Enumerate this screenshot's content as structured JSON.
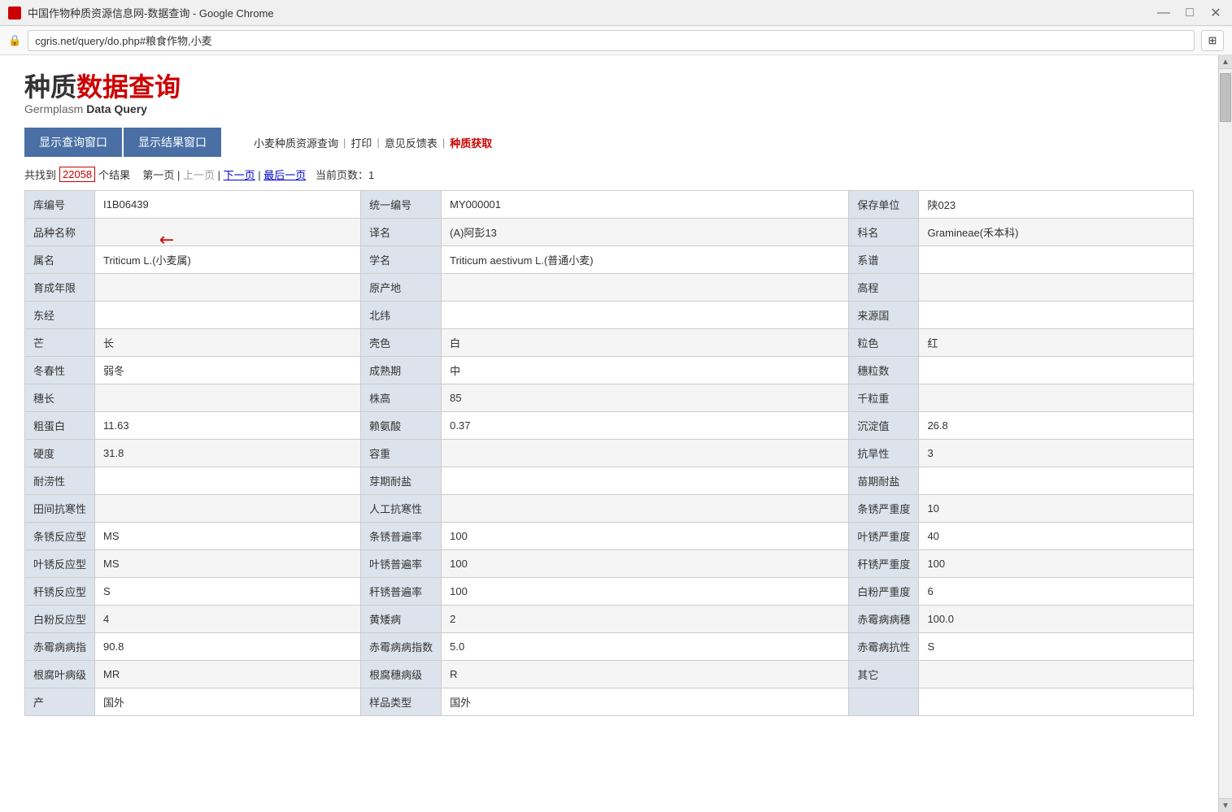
{
  "titlebar": {
    "title": "中国作物种质资源信息网-数据查询 - Google Chrome",
    "controls": {
      "minimize": "—",
      "maximize": "□",
      "close": "✕"
    }
  },
  "addressbar": {
    "url": "cgris.net/query/do.php#粮食作物,小麦",
    "lock_icon": "🔒"
  },
  "logo": {
    "part1": "种质",
    "part2": "数据查询",
    "subtitle_normal": "Germplasm",
    "subtitle_bold": "Data Query"
  },
  "toolbar": {
    "btn1": "显示查询窗口",
    "btn2": "显示结果窗口",
    "link_query": "小麦种质资源查询",
    "sep1": "|",
    "link_print": "打印",
    "sep2": "|",
    "link_feedback": "意见反馈表",
    "sep3": "|",
    "link_obtain": "种质获取"
  },
  "results": {
    "prefix": "共找到",
    "count": "22058",
    "suffix": "个结果",
    "pages": [
      {
        "label": "第一页",
        "active": false
      },
      {
        "label": "上一页",
        "active": false
      },
      {
        "label": "下一页",
        "active": true
      },
      {
        "label": "最后一页",
        "active": true
      }
    ],
    "current": "当前页数：1"
  },
  "table": {
    "rows": [
      {
        "cells": [
          {
            "label": "库编号",
            "value": "I1B06439"
          },
          {
            "label": "统一编号",
            "value": "MY000001"
          },
          {
            "label": "保存单位",
            "value": "陕023"
          }
        ]
      },
      {
        "cells": [
          {
            "label": "品种名称",
            "value": ""
          },
          {
            "label": "译名",
            "value": "(A)阿彭13"
          },
          {
            "label": "科名",
            "value": "Gramineae(禾本科)"
          }
        ]
      },
      {
        "cells": [
          {
            "label": "属名",
            "value": "Triticum L.(小麦属)"
          },
          {
            "label": "学名",
            "value": "Triticum aestivum L.(普通小麦)"
          },
          {
            "label": "系谱",
            "value": ""
          }
        ]
      },
      {
        "cells": [
          {
            "label": "育成年限",
            "value": ""
          },
          {
            "label": "原产地",
            "value": ""
          },
          {
            "label": "高程",
            "value": ""
          }
        ]
      },
      {
        "cells": [
          {
            "label": "东经",
            "value": ""
          },
          {
            "label": "北纬",
            "value": ""
          },
          {
            "label": "来源国",
            "value": ""
          }
        ]
      },
      {
        "cells": [
          {
            "label": "芒",
            "value": "长"
          },
          {
            "label": "壳色",
            "value": "白"
          },
          {
            "label": "粒色",
            "value": "红"
          }
        ]
      },
      {
        "cells": [
          {
            "label": "冬春性",
            "value": "弱冬"
          },
          {
            "label": "成熟期",
            "value": "中"
          },
          {
            "label": "穗粒数",
            "value": ""
          }
        ]
      },
      {
        "cells": [
          {
            "label": "穗长",
            "value": ""
          },
          {
            "label": "株高",
            "value": "85"
          },
          {
            "label": "千粒重",
            "value": ""
          }
        ]
      },
      {
        "cells": [
          {
            "label": "粗蛋白",
            "value": "11.63"
          },
          {
            "label": "赖氨酸",
            "value": "0.37"
          },
          {
            "label": "沉淀值",
            "value": "26.8"
          }
        ]
      },
      {
        "cells": [
          {
            "label": "硬度",
            "value": "31.8"
          },
          {
            "label": "容重",
            "value": ""
          },
          {
            "label": "抗旱性",
            "value": "3"
          }
        ]
      },
      {
        "cells": [
          {
            "label": "耐涝性",
            "value": ""
          },
          {
            "label": "芽期耐盐",
            "value": ""
          },
          {
            "label": "苗期耐盐",
            "value": ""
          }
        ]
      },
      {
        "cells": [
          {
            "label": "田间抗寒性",
            "value": ""
          },
          {
            "label": "人工抗寒性",
            "value": ""
          },
          {
            "label": "条锈严重度",
            "value": "10"
          }
        ]
      },
      {
        "cells": [
          {
            "label": "条锈反应型",
            "value": "MS"
          },
          {
            "label": "条锈普遍率",
            "value": "100"
          },
          {
            "label": "叶锈严重度",
            "value": "40"
          }
        ]
      },
      {
        "cells": [
          {
            "label": "叶锈反应型",
            "value": "MS"
          },
          {
            "label": "叶锈普遍率",
            "value": "100"
          },
          {
            "label": "秆锈严重度",
            "value": "100"
          }
        ]
      },
      {
        "cells": [
          {
            "label": "秆锈反应型",
            "value": "S"
          },
          {
            "label": "秆锈普遍率",
            "value": "100"
          },
          {
            "label": "白粉严重度",
            "value": "6"
          }
        ]
      },
      {
        "cells": [
          {
            "label": "白粉反应型",
            "value": "4"
          },
          {
            "label": "黄矮病",
            "value": "2"
          },
          {
            "label": "赤霉病病穗",
            "value": "100.0"
          }
        ]
      },
      {
        "cells": [
          {
            "label": "赤霉病病指",
            "value": "90.8"
          },
          {
            "label": "赤霉病病指数",
            "value": "5.0"
          },
          {
            "label": "赤霉病抗性",
            "value": "S"
          }
        ]
      },
      {
        "cells": [
          {
            "label": "根腐叶病级",
            "value": "MR"
          },
          {
            "label": "根腐穗病级",
            "value": "R"
          },
          {
            "label": "其它",
            "value": ""
          }
        ]
      },
      {
        "cells": [
          {
            "label": "产",
            "value": "国外"
          },
          {
            "label": "样品类型",
            "value": "国外"
          },
          {
            "label": "",
            "value": ""
          }
        ]
      }
    ]
  }
}
